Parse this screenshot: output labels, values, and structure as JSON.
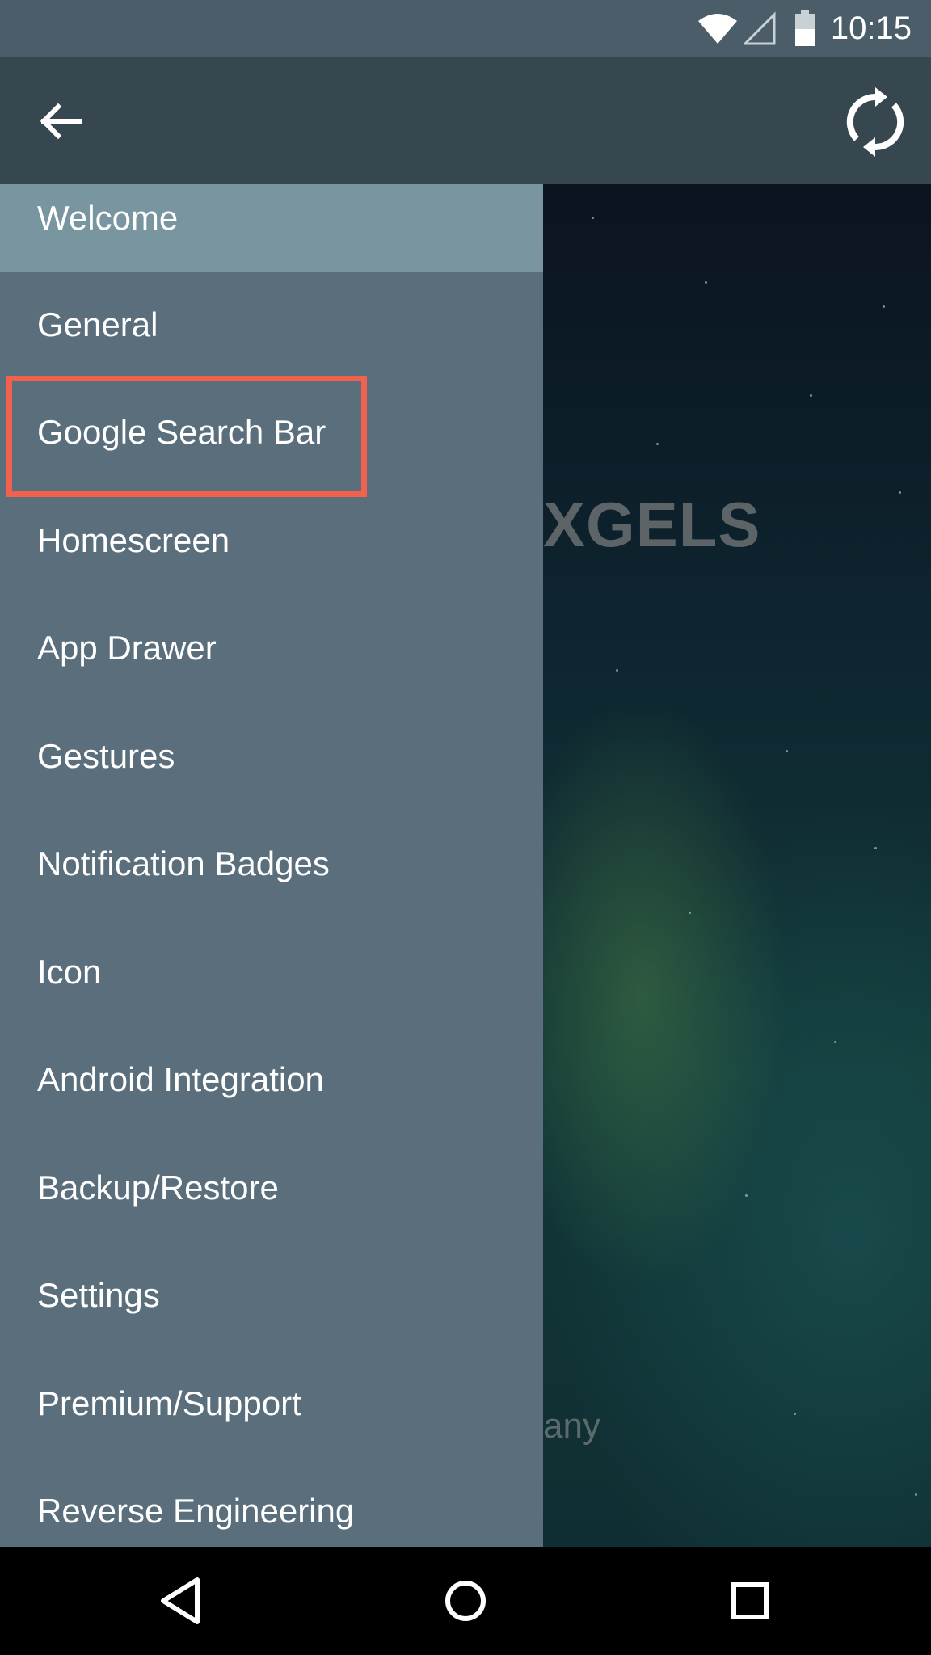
{
  "status_bar": {
    "time": "10:15",
    "icons": [
      "wifi-icon",
      "cellular-signal-icon",
      "battery-icon"
    ]
  },
  "app_bar": {
    "back_icon": "arrow-back-icon",
    "sync_icon": "sync-icon"
  },
  "drawer": {
    "items": [
      {
        "label": "Welcome",
        "active": true
      },
      {
        "label": "General",
        "active": false
      },
      {
        "label": "Google Search Bar",
        "active": false,
        "highlighted": true
      },
      {
        "label": "Homescreen",
        "active": false
      },
      {
        "label": "App Drawer",
        "active": false
      },
      {
        "label": "Gestures",
        "active": false
      },
      {
        "label": "Notification Badges",
        "active": false
      },
      {
        "label": "Icon",
        "active": false
      },
      {
        "label": "Android Integration",
        "active": false
      },
      {
        "label": "Backup/Restore",
        "active": false
      },
      {
        "label": "Settings",
        "active": false
      },
      {
        "label": "Premium/Support",
        "active": false
      },
      {
        "label": "Reverse Engineering",
        "active": false
      }
    ],
    "highlight_color": "#f2604e"
  },
  "background": {
    "brand_text": "XGELS",
    "company_text": "any"
  },
  "nav_bar": {
    "buttons": [
      "nav-back-icon",
      "home-icon",
      "recents-icon"
    ]
  },
  "colors": {
    "status_bar": "#4b5d68",
    "app_bar": "#37474f",
    "drawer": "#5a6f7b",
    "drawer_active": "#7995a0"
  }
}
